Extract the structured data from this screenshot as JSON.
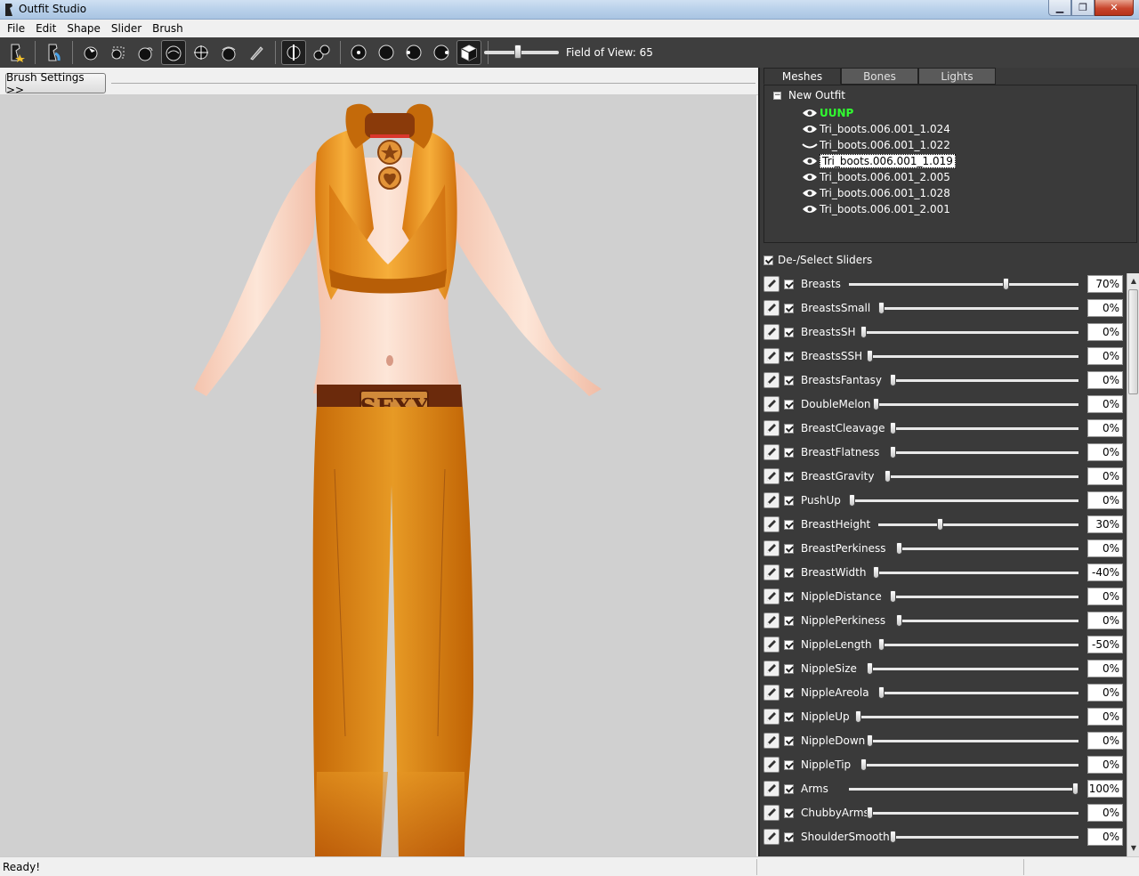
{
  "window": {
    "title": "Outfit Studio"
  },
  "menu": [
    "File",
    "Edit",
    "Shape",
    "Slider",
    "Brush"
  ],
  "toolbar": {
    "field_of_view_label": "Field of View: 65",
    "field_of_view_value": 65
  },
  "brush_settings_label": "Brush Settings >>",
  "tabs": [
    "Meshes",
    "Bones",
    "Lights"
  ],
  "tree": {
    "root": "New Outfit",
    "items": [
      {
        "label": "UUNP",
        "style": "green"
      },
      {
        "label": "Tri_boots.006.001_1.024"
      },
      {
        "label": "Tri_boots.006.001_1.022"
      },
      {
        "label": "Tri_boots.006.001_1.019",
        "style": "selected"
      },
      {
        "label": "Tri_boots.006.001_2.005"
      },
      {
        "label": "Tri_boots.006.001_1.028"
      },
      {
        "label": "Tri_boots.006.001_2.001"
      }
    ]
  },
  "sliders_header": "De-/Select Sliders",
  "sliders": [
    {
      "name": "Breasts",
      "value": "70%",
      "pos": 0.69
    },
    {
      "name": "BreastsSmall",
      "value": "0%",
      "pos": 0.0
    },
    {
      "name": "BreastsSH",
      "value": "0%",
      "pos": 0.0
    },
    {
      "name": "BreastsSSH",
      "value": "0%",
      "pos": 0.0
    },
    {
      "name": "BreastsFantasy",
      "value": "0%",
      "pos": 0.0
    },
    {
      "name": "DoubleMelon",
      "value": "0%",
      "pos": 0.0
    },
    {
      "name": "BreastCleavage",
      "value": "0%",
      "pos": 0.0
    },
    {
      "name": "BreastFlatness",
      "value": "0%",
      "pos": 0.0
    },
    {
      "name": "BreastGravity",
      "value": "0%",
      "pos": 0.0
    },
    {
      "name": "PushUp",
      "value": "0%",
      "pos": 0.0
    },
    {
      "name": "BreastHeight",
      "value": "30%",
      "pos": 0.3
    },
    {
      "name": "BreastPerkiness",
      "value": "0%",
      "pos": 0.0
    },
    {
      "name": "BreastWidth",
      "value": "-40%",
      "pos": 0.0
    },
    {
      "name": "NippleDistance",
      "value": "0%",
      "pos": 0.0
    },
    {
      "name": "NipplePerkiness",
      "value": "0%",
      "pos": 0.0
    },
    {
      "name": "NippleLength",
      "value": "-50%",
      "pos": 0.0
    },
    {
      "name": "NippleSize",
      "value": "0%",
      "pos": 0.0
    },
    {
      "name": "NippleAreola",
      "value": "0%",
      "pos": 0.0
    },
    {
      "name": "NippleUp",
      "value": "0%",
      "pos": 0.0
    },
    {
      "name": "NippleDown",
      "value": "0%",
      "pos": 0.0
    },
    {
      "name": "NippleTip",
      "value": "0%",
      "pos": 0.0
    },
    {
      "name": "Arms",
      "value": "100%",
      "pos": 1.0
    },
    {
      "name": "ChubbyArms",
      "value": "0%",
      "pos": 0.0
    },
    {
      "name": "ShoulderSmooth",
      "value": "0%",
      "pos": 0.0
    }
  ],
  "status": "Ready!",
  "colors": {
    "panel": "#3a3a3a",
    "toolbar": "#3e3e3e",
    "viewport": "#d0d0d0",
    "accent_green": "#30ff30"
  }
}
